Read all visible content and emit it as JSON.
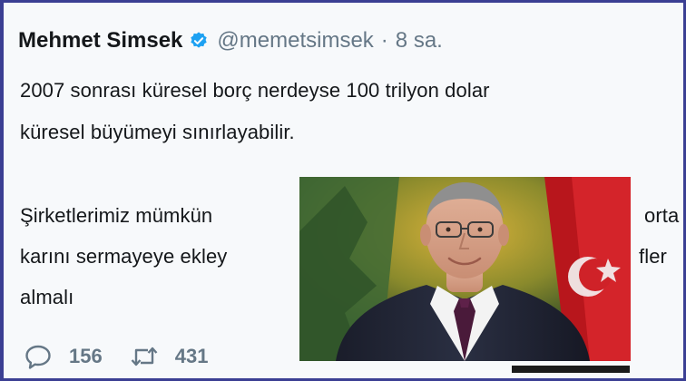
{
  "tweet": {
    "author_name": "Mehmet Simsek",
    "handle": "@memetsimsek",
    "separator": "·",
    "time": "8 sa.",
    "line1": "2007 sonrası küresel borç nerdeyse 100 trilyon dolar",
    "line2": "küresel büyümeyi sınırlayabilir.",
    "line3_left": "Şirketlerimiz mümkün",
    "line3_right": "orta",
    "line4_left": "karını sermayeye ekley",
    "line4_right": "fler",
    "line5": "almalı"
  },
  "actions": {
    "reply_count": "156",
    "retweet_count": "431"
  },
  "colors": {
    "frame_border": "#3b3f93",
    "text_primary": "#14171a",
    "text_secondary": "#657786",
    "verified_badge": "#1da1f2"
  },
  "icons": [
    "verified-badge-icon",
    "reply-icon",
    "retweet-icon"
  ]
}
